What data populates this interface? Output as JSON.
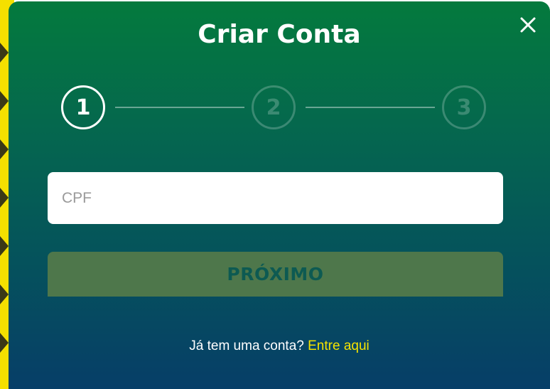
{
  "modal": {
    "title": "Criar Conta",
    "close_icon": "close-icon"
  },
  "stepper": {
    "steps": [
      {
        "label": "1",
        "state": "active"
      },
      {
        "label": "2",
        "state": "inactive"
      },
      {
        "label": "3",
        "state": "inactive"
      }
    ]
  },
  "form": {
    "cpf_placeholder": "CPF",
    "cpf_value": "",
    "next_label": "PRÓXIMO"
  },
  "footer": {
    "prompt": "Já tem uma conta?",
    "link_label": "Entre aqui"
  },
  "colors": {
    "gradient_top": "#047a3d",
    "gradient_bottom": "#063e68",
    "button_bg": "#4e774b",
    "button_text": "#0d5a52",
    "link": "#f5e300",
    "brand_yellow": "#f5e000"
  }
}
